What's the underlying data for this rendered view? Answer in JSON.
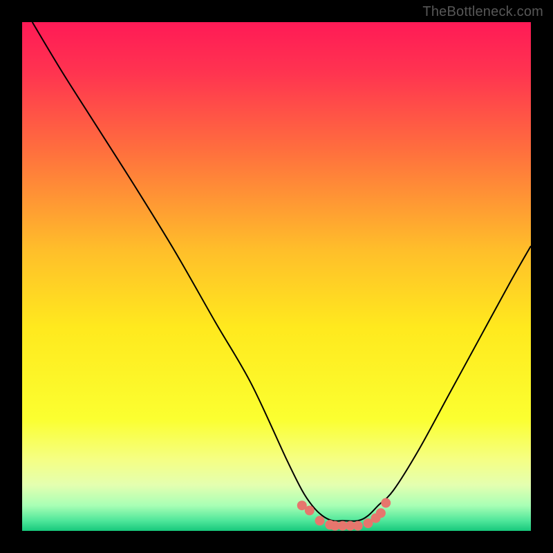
{
  "watermark": "TheBottleneck.com",
  "chart_data": {
    "type": "line",
    "title": "",
    "xlabel": "",
    "ylabel": "",
    "xlim": [
      0,
      100
    ],
    "ylim": [
      0,
      100
    ],
    "background": {
      "type": "vertical-gradient",
      "stops": [
        {
          "pos": 0.0,
          "color": "#ff1a56"
        },
        {
          "pos": 0.1,
          "color": "#ff3450"
        },
        {
          "pos": 0.25,
          "color": "#ff6e3e"
        },
        {
          "pos": 0.45,
          "color": "#ffbf2a"
        },
        {
          "pos": 0.6,
          "color": "#ffe91e"
        },
        {
          "pos": 0.78,
          "color": "#fbff30"
        },
        {
          "pos": 0.86,
          "color": "#f5ff84"
        },
        {
          "pos": 0.91,
          "color": "#e4ffb0"
        },
        {
          "pos": 0.95,
          "color": "#a9ffb5"
        },
        {
          "pos": 0.98,
          "color": "#4fe69a"
        },
        {
          "pos": 1.0,
          "color": "#17c87c"
        }
      ]
    },
    "series": [
      {
        "name": "bottleneck-curve",
        "color": "#000000",
        "x": [
          2,
          8,
          15,
          22,
          30,
          38,
          45,
          52,
          55,
          57,
          59,
          61,
          63,
          66,
          68,
          70,
          73,
          78,
          84,
          90,
          96,
          100
        ],
        "y": [
          100,
          90,
          79,
          68,
          55,
          41,
          29,
          14,
          8,
          5,
          3,
          2,
          2,
          2,
          3,
          5,
          8,
          16,
          27,
          38,
          49,
          56
        ]
      },
      {
        "name": "trough-markers",
        "color": "#e6766d",
        "type": "scatter",
        "x": [
          55.0,
          56.5,
          58.5,
          60.5,
          61.5,
          63.0,
          64.5,
          66.0,
          68.0,
          69.5,
          70.5,
          71.5
        ],
        "y": [
          5.0,
          4.0,
          2.0,
          1.2,
          1.0,
          1.0,
          1.0,
          1.0,
          1.5,
          2.5,
          3.5,
          5.5
        ]
      }
    ]
  }
}
